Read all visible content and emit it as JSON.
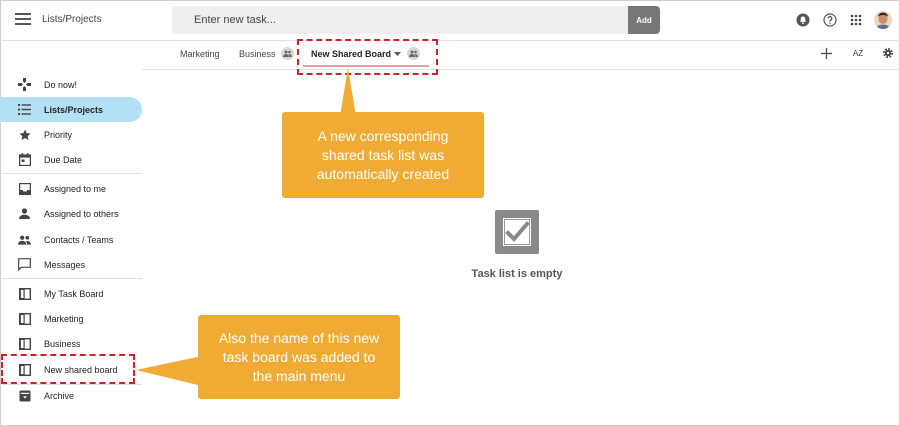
{
  "app": {
    "title": "Lists/Projects"
  },
  "search": {
    "placeholder": "Enter new task...",
    "add_label": "Add"
  },
  "tabs": [
    {
      "label": "Marketing"
    },
    {
      "label": "Business",
      "shared": true
    },
    {
      "label": "New Shared Board",
      "shared": true,
      "active": true
    }
  ],
  "toolbar": {
    "sort_label": "AZ"
  },
  "sidebar": {
    "items": [
      {
        "label": "Do now!",
        "icon": "gamepad-icon"
      },
      {
        "label": "Lists/Projects",
        "icon": "list-icon",
        "active": true
      },
      {
        "label": "Priority",
        "icon": "star-icon"
      },
      {
        "label": "Due Date",
        "icon": "calendar-icon"
      },
      {
        "label": "Assigned to me",
        "icon": "inbox-icon"
      },
      {
        "label": "Assigned to others",
        "icon": "person-icon"
      },
      {
        "label": "Contacts / Teams",
        "icon": "people-icon"
      },
      {
        "label": "Messages",
        "icon": "message-icon"
      },
      {
        "label": "My Task Board",
        "icon": "board-icon"
      },
      {
        "label": "Marketing",
        "icon": "board-icon"
      },
      {
        "label": "Business",
        "icon": "board-icon"
      },
      {
        "label": "New shared board",
        "icon": "board-icon"
      },
      {
        "label": "Archive",
        "icon": "archive-icon"
      }
    ]
  },
  "empty_state": {
    "text": "Task list is empty"
  },
  "callouts": {
    "top": "A new corresponding shared task list was automatically created",
    "bottom": "Also the name of this new task board was added to the main menu"
  },
  "colors": {
    "accent": "#b3e0f5",
    "callout": "#f0ab35",
    "highlight": "#d0202a"
  }
}
